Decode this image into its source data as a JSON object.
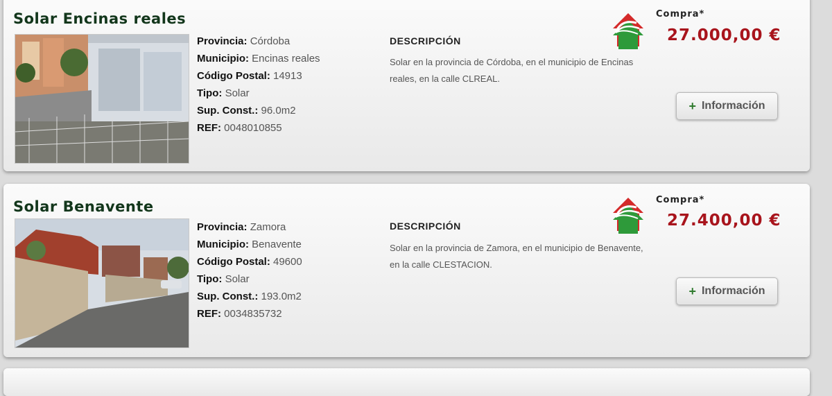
{
  "listings": [
    {
      "title": "Solar Encinas reales",
      "photo_alt": "Fotografía del solar",
      "fields": [
        {
          "label": "Provincia:",
          "value": "Córdoba"
        },
        {
          "label": "Municipio:",
          "value": "Encinas reales"
        },
        {
          "label": "Código Postal:",
          "value": "14913"
        },
        {
          "label": "Tipo:",
          "value": "Solar"
        },
        {
          "label": "Sup. Const.:",
          "value": "96.0m2"
        },
        {
          "label": "REF:",
          "value": "0048010855"
        }
      ],
      "description_heading": "DESCRIPCIÓN",
      "description": "Solar en la provincia de Córdoba, en el municipio de Encinas reales, en la calle CLREAL.",
      "price_label": "Compra*",
      "price": "27.000,00 €",
      "info_button": {
        "icon": "+",
        "label": "Información"
      }
    },
    {
      "title": "Solar Benavente",
      "photo_alt": "Fotografía del solar",
      "fields": [
        {
          "label": "Provincia:",
          "value": "Zamora"
        },
        {
          "label": "Municipio:",
          "value": "Benavente"
        },
        {
          "label": "Código Postal:",
          "value": "49600"
        },
        {
          "label": "Tipo:",
          "value": "Solar"
        },
        {
          "label": "Sup. Const.:",
          "value": "193.0m2"
        },
        {
          "label": "REF:",
          "value": "0034835732"
        }
      ],
      "description_heading": "DESCRIPCIÓN",
      "description": "Solar en la provincia de Zamora, en el municipio de Benavente, en la calle CLESTACION.",
      "price_label": "Compra*",
      "price": "27.400,00 €",
      "info_button": {
        "icon": "+",
        "label": "Información"
      }
    }
  ],
  "colors": {
    "title": "#12361b",
    "price": "#a8141c",
    "logo_red": "#d42a2a",
    "logo_green": "#2e9a3a"
  },
  "icons": {
    "logo": "bank-house-logo-icon",
    "plus": "plus-icon"
  }
}
